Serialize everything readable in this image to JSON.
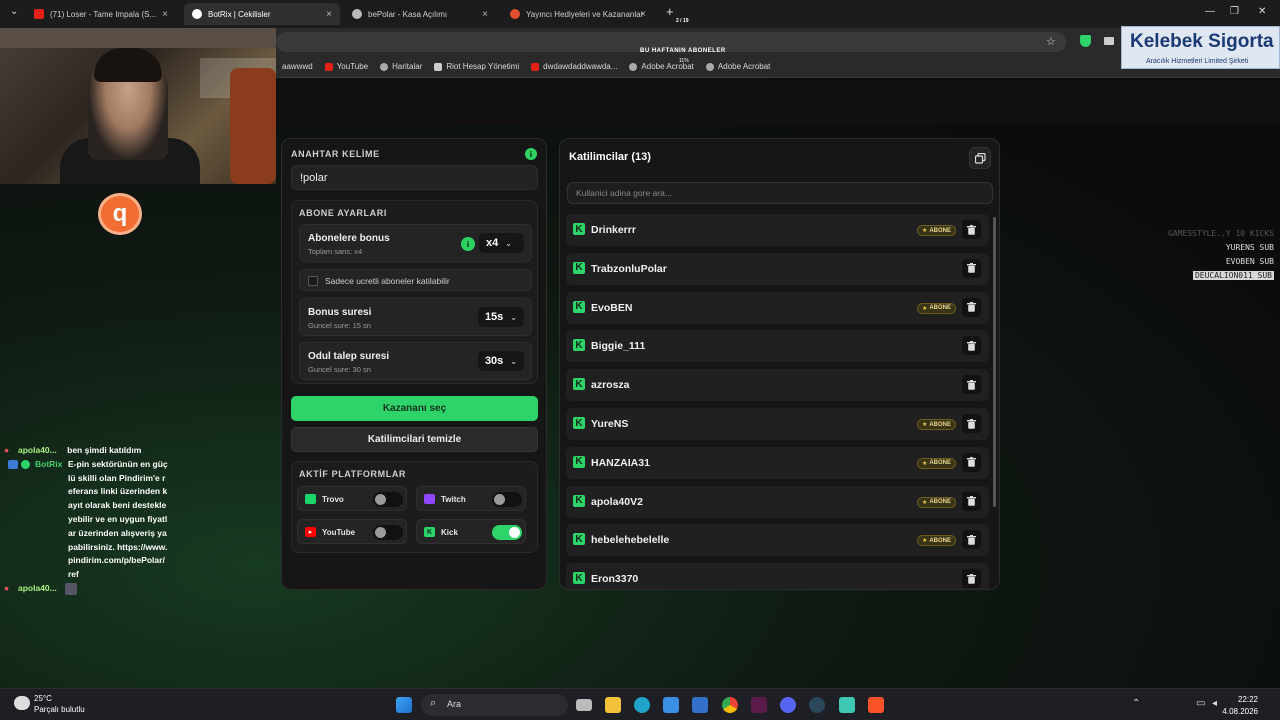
{
  "browser": {
    "tabs": [
      {
        "title": "(71) Loser - Tame Impala (S...",
        "color": "#e62117"
      },
      {
        "title": "BotRix | Cekilisler",
        "color": "#ffffff"
      },
      {
        "title": "bePolar - Kasa Açılımı",
        "color": "#cccccc"
      },
      {
        "title": "Yayıncı Hediyeleri ve Kazananlar",
        "color": "#e2502d"
      }
    ],
    "new_tab": "+",
    "bookmarks": [
      {
        "label": "aawwwd",
        "color": "#888888"
      },
      {
        "label": "YouTube",
        "color": "#e62117"
      },
      {
        "label": "Haritalar",
        "color": "#cccccc"
      },
      {
        "label": "Riot Hesap Yönetimi",
        "color": "#cccccc"
      },
      {
        "label": "dwdawdaddwawda...",
        "color": "#e62117"
      },
      {
        "label": "Adobe Acrobat",
        "color": "#cccccc"
      },
      {
        "label": "Adobe Acrobat",
        "color": "#cccccc"
      }
    ]
  },
  "overlay": {
    "subs_title": "BU HAFTANIN ABONELER",
    "subs_count": "2 / 19",
    "subs_pct": "11%",
    "sponsor_name": "Kelebek Sigorta",
    "sponsor_sub": "Aracılık Hizmetleri Limited Şirketi",
    "sub_feed": [
      "GAMESSTYLE..Y 10 KICKS",
      "YURENS SUB",
      "EVOBEN SUB",
      "DEUCALION011 SUB"
    ],
    "logo_letter": "q"
  },
  "keyword": {
    "label": "ANAHTAR KELİME",
    "value": "!polar",
    "info": "i"
  },
  "sub_settings": {
    "label": "ABONE AYARLARI",
    "bonus": {
      "title": "Abonelere bonus",
      "sub": "Toplam sans: x4",
      "value": "x4"
    },
    "only_paid": "Sadece ucretli aboneler katilabilir",
    "bonus_time": {
      "title": "Bonus suresi",
      "sub": "Guncel sure: 15 sn",
      "value": "15s"
    },
    "claim_time": {
      "title": "Odul talep suresi",
      "sub": "Guncel sure: 30 sn",
      "value": "30s"
    }
  },
  "buttons": {
    "pick_winner": "Kazananı seç",
    "clear": "Katilimcilari temizle"
  },
  "platforms": {
    "label": "AKTİF PLATFORMLAR",
    "items": [
      {
        "name": "Trovo",
        "color": "#19d66b",
        "on": false
      },
      {
        "name": "Twitch",
        "color": "#9146ff",
        "on": false
      },
      {
        "name": "YouTube",
        "color": "#ff0000",
        "on": false
      },
      {
        "name": "Kick",
        "color": "#2ed46a",
        "on": true
      }
    ]
  },
  "participants": {
    "title": "Katilimcilar (13)",
    "search_placeholder": "Kullanici adina gore ara...",
    "badge_label": "ABONE",
    "list": [
      {
        "name": "Drinkerrr",
        "sub": true
      },
      {
        "name": "TrabzonluPolar",
        "sub": false
      },
      {
        "name": "EvoBEN",
        "sub": true
      },
      {
        "name": "Biggie_111",
        "sub": false
      },
      {
        "name": "azrosza",
        "sub": false
      },
      {
        "name": "YureNS",
        "sub": true
      },
      {
        "name": "HANZAIA31",
        "sub": true
      },
      {
        "name": "apola40V2",
        "sub": true
      },
      {
        "name": "hebelehebelelle",
        "sub": true
      },
      {
        "name": "Eron3370",
        "sub": false
      }
    ]
  },
  "chat": [
    {
      "user": "apola40...",
      "msg": "ben şimdi katıldım",
      "bot": false
    },
    {
      "user": "BotRix",
      "msg": "E-pin sektörünün en güçlü skilli olan Pindirim'e referans linki üzerinden kayıt olarak beni destekleyebilir ve en uygun fiyatlar üzerinden alışveriş yapabilirsiniz. https://www.pindirim.com/p/bePolar/ref",
      "bot": true
    },
    {
      "user": "apola40...",
      "msg": "",
      "bot": false
    }
  ],
  "taskbar": {
    "temp": "25°C",
    "weather": "Parçalı bulutlu",
    "search": "Ara",
    "time": "22:22",
    "date": "4.08.2026"
  }
}
